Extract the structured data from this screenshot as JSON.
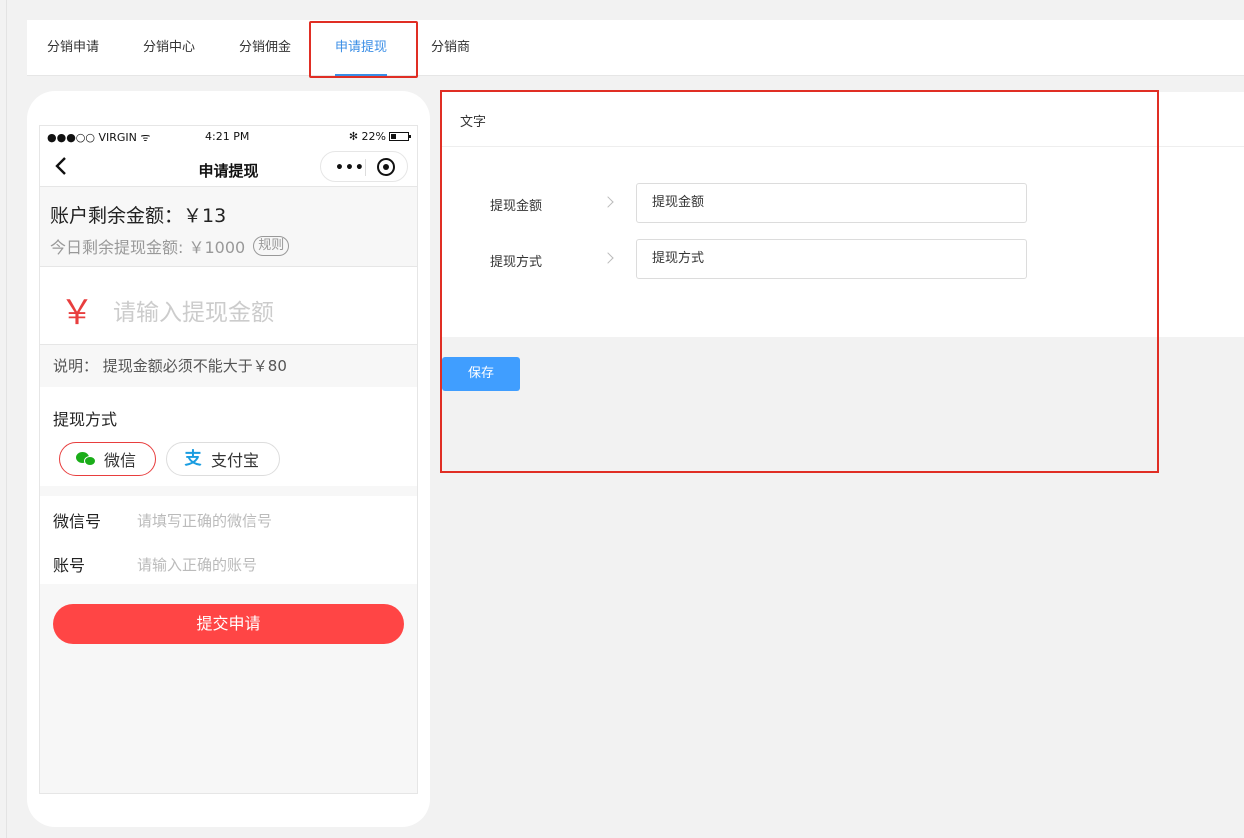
{
  "tabs": [
    {
      "label": "分销申请"
    },
    {
      "label": "分销中心"
    },
    {
      "label": "分销佣金"
    },
    {
      "label": "申请提现",
      "active": true
    },
    {
      "label": "分销商"
    }
  ],
  "phone": {
    "status": {
      "carrier": "●●●○○ VIRGIN ᯤ",
      "time": "4:21 PM",
      "battery": "✻ 22%"
    },
    "nav": {
      "title": "申请提现",
      "more": "•••"
    },
    "balance": {
      "main": "账户剩余金额：￥13",
      "sub": "今日剩余提现金额: ￥1000",
      "rule": "规则"
    },
    "amount": {
      "symbol": "￥",
      "placeholder": "请输入提现金额"
    },
    "note": "说明： 提现金额必须不能大于￥80",
    "method": {
      "title": "提现方式",
      "options": [
        {
          "label": "微信",
          "selected": true
        },
        {
          "label": "支付宝",
          "selected": false
        }
      ]
    },
    "fields": [
      {
        "label": "微信号",
        "placeholder": "请填写正确的微信号"
      },
      {
        "label": "账号",
        "placeholder": "请输入正确的账号"
      }
    ],
    "submit": "提交申请"
  },
  "settings": {
    "header": "文字",
    "rows": [
      {
        "label": "提现金额",
        "value": "提现金额"
      },
      {
        "label": "提现方式",
        "value": "提现方式"
      }
    ],
    "save": "保存"
  },
  "colors": {
    "accent": "#3a8ee6",
    "highlight": "#e02e24",
    "primary_red": "#ff4545",
    "save_blue": "#409eff",
    "wechat_green": "#1aad19",
    "alipay_blue": "#1a9de1"
  }
}
